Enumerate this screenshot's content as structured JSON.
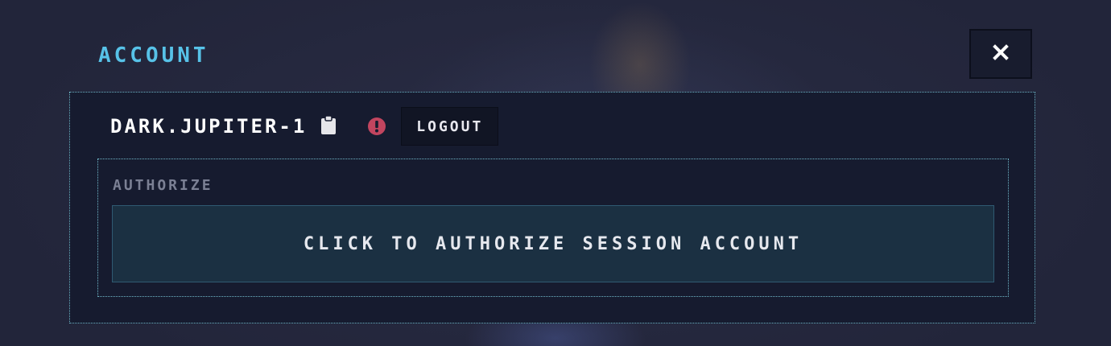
{
  "header": {
    "title": "ACCOUNT",
    "close_icon": "close-icon"
  },
  "account": {
    "name": "DARK.JUPITER-1",
    "copy_icon": "clipboard-icon",
    "alert_icon": "exclamation-circle-icon",
    "logout_label": "LOGOUT"
  },
  "authorize": {
    "label": "AUTHORIZE",
    "button_label": "CLICK TO AUTHORIZE SESSION ACCOUNT"
  },
  "colors": {
    "accent": "#57c2e8",
    "alert": "#c2455f",
    "panel_bg": "#161b2f",
    "authorize_bg": "#1b3042"
  }
}
